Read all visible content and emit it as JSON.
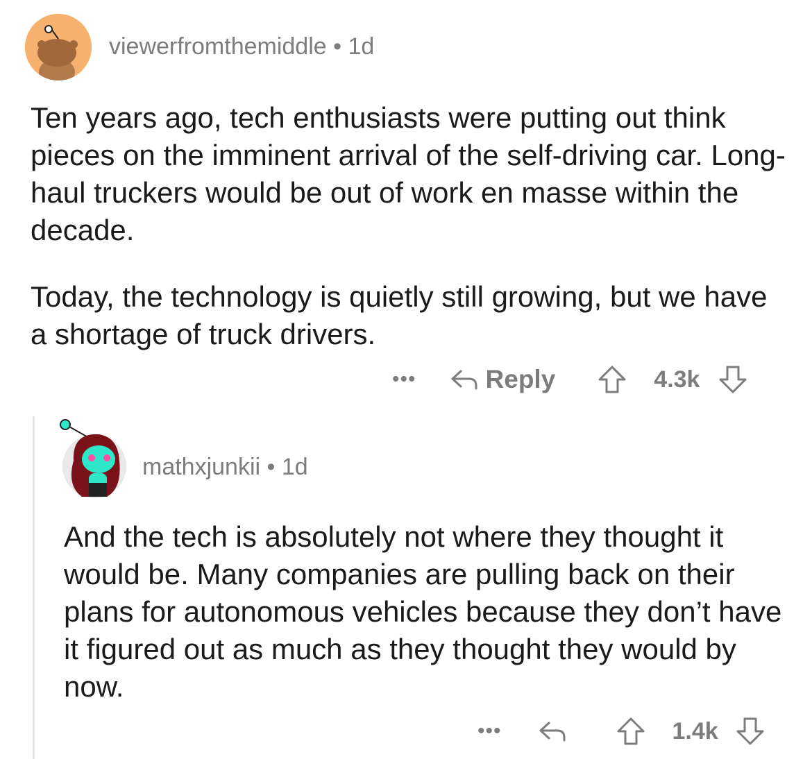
{
  "comments": [
    {
      "username": "viewerfromthemiddle",
      "separator": "•",
      "age": "1d",
      "avatar": "reddit-snoo-avatar-icon",
      "paragraphs": [
        "Ten years ago, tech enthusiasts were putting out think pieces on the imminent arrival of the self-driving car. Long-haul truckers would be out of work en masse within the decade.",
        "Today, the technology is quietly still growing, but we have a shortage of truck drivers."
      ],
      "more_label": "•••",
      "reply_label": "Reply",
      "score": "4.3k"
    },
    {
      "username": "mathxjunkii",
      "separator": "•",
      "age": "1d",
      "avatar": "reddit-snoo-avatar-icon",
      "paragraphs": [
        "And the tech is absolutely not where they thought it would be. Many companies are pulling back on their plans for autonomous vehicles because they don’t have it figured out as much as they thought they would by now."
      ],
      "more_label": "•••",
      "score": "1.4k"
    }
  ],
  "colors": {
    "meta_text": "#7c7c7c",
    "body_text": "#1a1a1b",
    "thread_line": "#e6e6e6",
    "avatar1_bg": "#f6b16e",
    "avatar2_skin": "#2ee6c8",
    "avatar2_hair": "#7a1219"
  }
}
